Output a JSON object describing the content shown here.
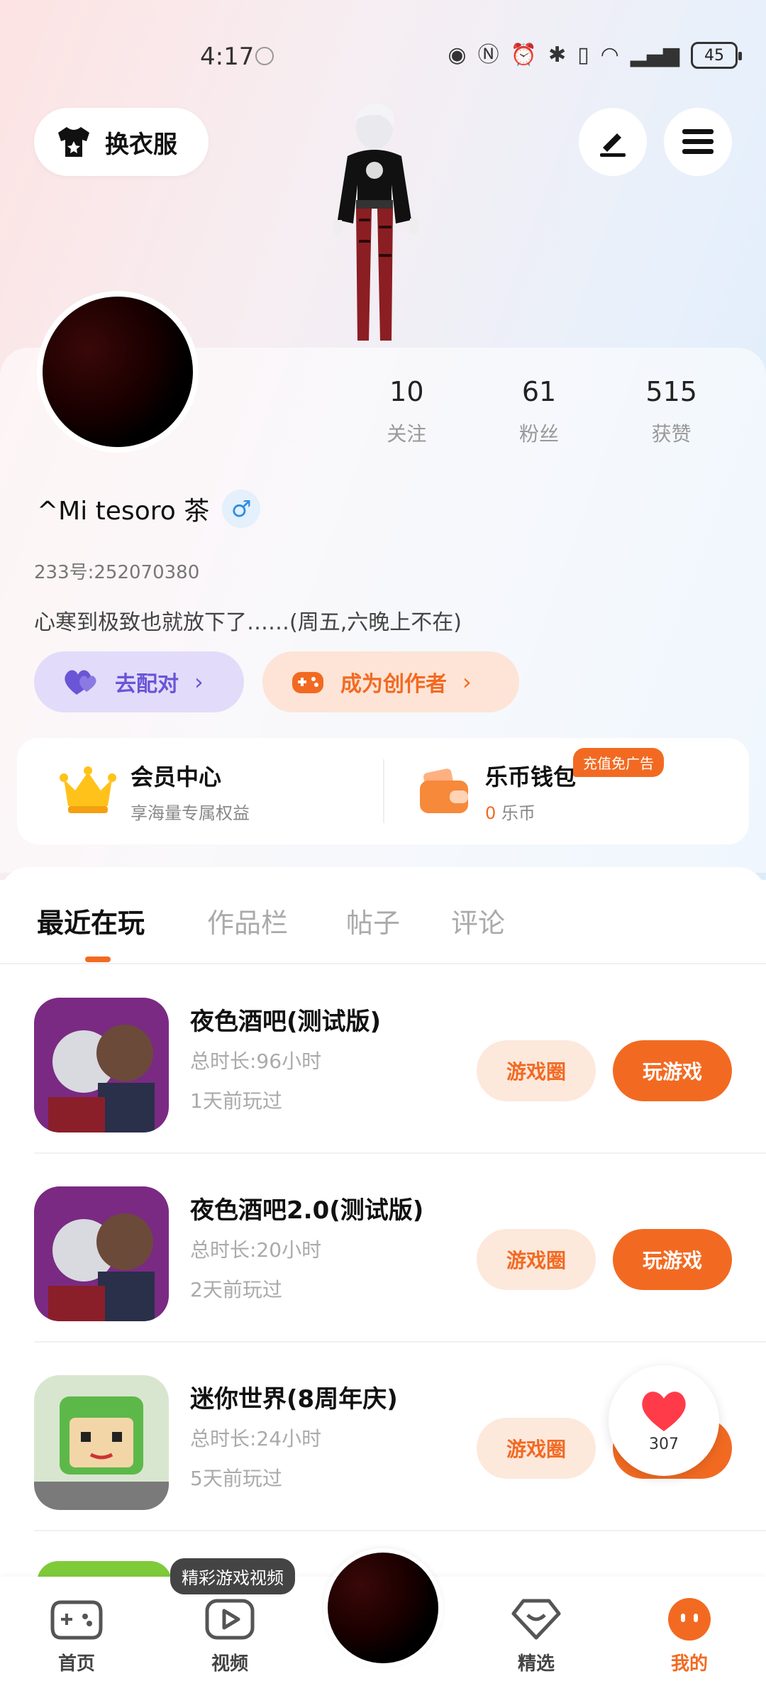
{
  "status_bar": {
    "time": "4:17",
    "battery": "45"
  },
  "header": {
    "outfit_label": "换衣服"
  },
  "profile": {
    "stats": [
      {
        "value": "10",
        "label": "关注"
      },
      {
        "value": "61",
        "label": "粉丝"
      },
      {
        "value": "515",
        "label": "获赞"
      }
    ],
    "username": "^Mi tesoro 茶",
    "gender_symbol": "♂",
    "uid": "233号:252070380",
    "bio": "心寒到极致也就放下了……(周五,六晚上不在)",
    "match_label": "去配对",
    "creator_label": "成为创作者"
  },
  "services": {
    "vip_title": "会员中心",
    "vip_sub": "享海量专属权益",
    "wallet_title": "乐币钱包",
    "wallet_amount": "0",
    "wallet_unit": "乐币",
    "recharge_badge": "充值免广告"
  },
  "tabs": [
    {
      "label": "最近在玩",
      "active": true
    },
    {
      "label": "作品栏",
      "active": false
    },
    {
      "label": "帖子",
      "active": false
    },
    {
      "label": "评论",
      "active": false
    }
  ],
  "games": [
    {
      "title": "夜色酒吧(测试版)",
      "duration": "总时长:96小时",
      "last": "1天前玩过",
      "circle": "游戏圈",
      "play": "玩游戏"
    },
    {
      "title": "夜色酒吧2.0(测试版)",
      "duration": "总时长:20小时",
      "last": "2天前玩过",
      "circle": "游戏圈",
      "play": "玩游戏"
    },
    {
      "title": "迷你世界(8周年庆)",
      "duration": "总时长:24小时",
      "last": "5天前玩过",
      "circle": "游戏圈",
      "play": "玩游戏"
    }
  ],
  "like_float": {
    "count": "307"
  },
  "bottom_nav": {
    "video_tip": "精彩游戏视频",
    "items": [
      {
        "label": "首页"
      },
      {
        "label": "视频"
      },
      {
        "label": "精选"
      },
      {
        "label": "我的"
      }
    ]
  },
  "colors": {
    "accent": "#f26a22",
    "match": "#6a55d6",
    "gender": "#2b8de6"
  }
}
